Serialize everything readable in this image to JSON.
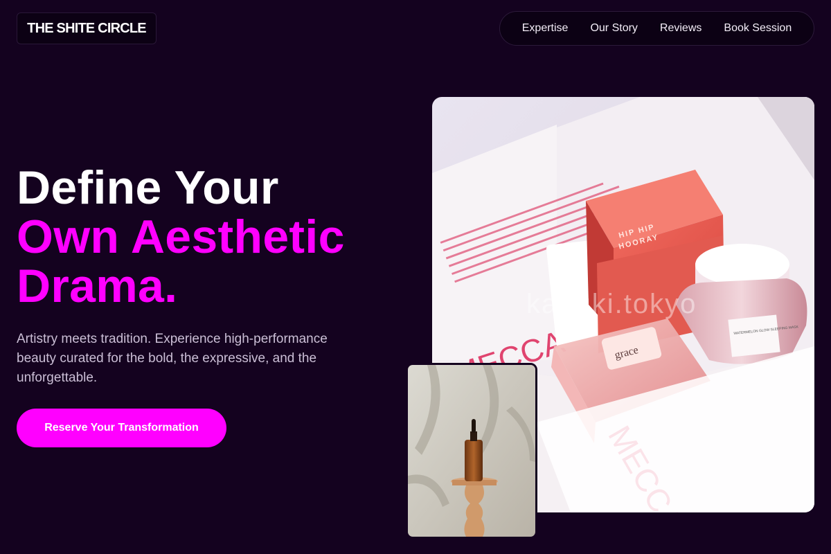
{
  "header": {
    "logo": "THE SHITE CIRCLE",
    "nav": [
      "Expertise",
      "Our Story",
      "Reviews",
      "Book Session"
    ]
  },
  "hero": {
    "title_line1": "Define Your",
    "title_line2": "Own Aesthetic Drama.",
    "subtitle": "Artistry meets tradition. Experience high-performance beauty curated for the bold, the expressive, and the unforgettable.",
    "cta": "Reserve Your Transformation"
  },
  "images": {
    "main_box_text": "MECCA",
    "main_watermark": "kabuki.tokyo",
    "cube_label_1": "HIP HIP",
    "cube_label_2": "HOORAY",
    "jar_label": "WATERMELON GLOW SLEEPING MASK",
    "bottle_label": "grace"
  },
  "colors": {
    "background": "#14021f",
    "accent": "#ff00ff",
    "text": "#ffffff",
    "muted": "#cbbfd6"
  }
}
